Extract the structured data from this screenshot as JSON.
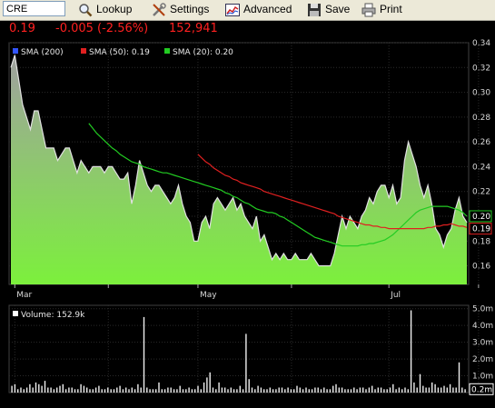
{
  "toolbar": {
    "ticker": "CRE",
    "lookup_label": "Lookup",
    "settings_label": "Settings",
    "advanced_label": "Advanced",
    "save_label": "Save",
    "print_label": "Print"
  },
  "quote": {
    "price": "0.19",
    "change": "-0.005 (-2.56%)",
    "volume": "152,941"
  },
  "colors": {
    "price_text": "#ff2020",
    "sma200": "#3355ff",
    "sma50": "#e02020",
    "sma20": "#22cc22",
    "area_top": "#a0a0a0",
    "area_bottom": "#7cf03c",
    "volume_bar": "#f0f0f0"
  },
  "chart_data": [
    {
      "type": "area",
      "legend": [
        {
          "name": "SMA (200)",
          "value": ""
        },
        {
          "name": "SMA (50)",
          "value": "0.19"
        },
        {
          "name": "SMA (20)",
          "value": "0.20"
        }
      ],
      "x_ticks": [
        "Mar",
        "May",
        "Jul"
      ],
      "y_ticks": [
        "0.34",
        "0.32",
        "0.30",
        "0.28",
        "0.26",
        "0.24",
        "0.22",
        "0.20",
        "0.18",
        "0.16"
      ],
      "ylim": [
        0.145,
        0.34
      ],
      "grid": true,
      "last_value_markers": [
        "0.20",
        "0.19"
      ],
      "series": [
        {
          "name": "Price",
          "values": [
            0.32,
            0.33,
            0.31,
            0.29,
            0.28,
            0.27,
            0.285,
            0.285,
            0.27,
            0.255,
            0.255,
            0.255,
            0.245,
            0.25,
            0.255,
            0.255,
            0.245,
            0.235,
            0.245,
            0.24,
            0.235,
            0.24,
            0.24,
            0.24,
            0.235,
            0.24,
            0.24,
            0.235,
            0.23,
            0.23,
            0.235,
            0.21,
            0.225,
            0.245,
            0.235,
            0.225,
            0.22,
            0.225,
            0.225,
            0.22,
            0.215,
            0.21,
            0.215,
            0.225,
            0.21,
            0.2,
            0.195,
            0.18,
            0.18,
            0.195,
            0.2,
            0.19,
            0.21,
            0.215,
            0.21,
            0.205,
            0.21,
            0.215,
            0.205,
            0.21,
            0.2,
            0.195,
            0.19,
            0.2,
            0.18,
            0.185,
            0.175,
            0.165,
            0.17,
            0.165,
            0.17,
            0.165,
            0.165,
            0.17,
            0.165,
            0.165,
            0.165,
            0.17,
            0.165,
            0.16,
            0.16,
            0.16,
            0.16,
            0.17,
            0.185,
            0.2,
            0.19,
            0.2,
            0.195,
            0.19,
            0.2,
            0.205,
            0.215,
            0.21,
            0.22,
            0.225,
            0.225,
            0.215,
            0.225,
            0.21,
            0.215,
            0.245,
            0.26,
            0.25,
            0.24,
            0.225,
            0.215,
            0.225,
            0.21,
            0.19,
            0.185,
            0.175,
            0.185,
            0.19,
            0.205,
            0.215,
            0.2,
            0.195
          ]
        },
        {
          "name": "SMA (20)",
          "values": [
            0.275,
            0.271,
            0.267,
            0.264,
            0.261,
            0.258,
            0.255,
            0.253,
            0.25,
            0.248,
            0.246,
            0.244,
            0.243,
            0.242,
            0.24,
            0.239,
            0.238,
            0.237,
            0.236,
            0.235,
            0.235,
            0.234,
            0.233,
            0.232,
            0.231,
            0.23,
            0.229,
            0.228,
            0.227,
            0.226,
            0.225,
            0.224,
            0.223,
            0.222,
            0.221,
            0.219,
            0.218,
            0.216,
            0.215,
            0.213,
            0.211,
            0.21,
            0.208,
            0.206,
            0.205,
            0.204,
            0.203,
            0.203,
            0.202,
            0.2,
            0.199,
            0.197,
            0.195,
            0.193,
            0.191,
            0.189,
            0.187,
            0.185,
            0.183,
            0.182,
            0.181,
            0.18,
            0.179,
            0.178,
            0.177,
            0.176,
            0.176,
            0.176,
            0.176,
            0.176,
            0.177,
            0.177,
            0.178,
            0.178,
            0.179,
            0.18,
            0.181,
            0.183,
            0.185,
            0.188,
            0.191,
            0.194,
            0.197,
            0.2,
            0.203,
            0.205,
            0.206,
            0.207,
            0.208,
            0.208,
            0.208,
            0.208,
            0.208,
            0.207,
            0.206,
            0.205,
            0.203,
            0.2
          ],
          "x_offset": 20
        },
        {
          "name": "SMA (50)",
          "values": [
            0.25,
            0.247,
            0.244,
            0.242,
            0.239,
            0.237,
            0.235,
            0.233,
            0.232,
            0.23,
            0.229,
            0.227,
            0.226,
            0.225,
            0.224,
            0.223,
            0.222,
            0.22,
            0.219,
            0.218,
            0.217,
            0.216,
            0.215,
            0.214,
            0.213,
            0.212,
            0.211,
            0.21,
            0.209,
            0.208,
            0.207,
            0.206,
            0.205,
            0.204,
            0.203,
            0.202,
            0.2,
            0.199,
            0.198,
            0.197,
            0.196,
            0.195,
            0.194,
            0.193,
            0.193,
            0.192,
            0.192,
            0.191,
            0.191,
            0.19,
            0.19,
            0.19,
            0.19,
            0.19,
            0.19,
            0.19,
            0.19,
            0.19,
            0.19,
            0.191,
            0.191,
            0.192,
            0.192,
            0.193,
            0.193,
            0.194,
            0.193,
            0.192,
            0.192,
            0.191
          ],
          "x_offset": 48
        }
      ]
    },
    {
      "type": "bar",
      "legend": [
        {
          "name": "Volume:",
          "value": "152.9k"
        }
      ],
      "y_ticks": [
        "5.0m",
        "4.0m",
        "3.0m",
        "2.0m",
        "1.0m"
      ],
      "last_value_marker": "0.2m",
      "ylim": [
        0,
        5.2
      ],
      "series": [
        {
          "name": "Volume",
          "values": [
            0.4,
            0.5,
            0.2,
            0.3,
            0.2,
            0.3,
            0.5,
            0.3,
            0.6,
            0.5,
            0.4,
            0.7,
            0.3,
            0.3,
            0.2,
            0.3,
            0.4,
            0.5,
            0.2,
            0.3,
            0.3,
            0.2,
            0.2,
            0.5,
            0.4,
            0.3,
            0.2,
            0.2,
            0.3,
            0.4,
            0.2,
            0.2,
            0.3,
            0.2,
            0.2,
            0.3,
            0.4,
            0.2,
            0.3,
            0.2,
            0.3,
            0.2,
            0.5,
            0.3,
            4.5,
            0.3,
            0.2,
            0.2,
            0.2,
            0.6,
            0.2,
            0.2,
            0.3,
            0.3,
            0.2,
            0.2,
            0.4,
            0.2,
            0.2,
            0.3,
            0.2,
            0.2,
            0.4,
            0.2,
            0.6,
            0.9,
            1.2,
            0.3,
            0.2,
            0.6,
            0.3,
            0.3,
            0.2,
            0.3,
            0.2,
            0.2,
            0.4,
            0.2,
            3.5,
            0.8,
            0.3,
            0.2,
            0.4,
            0.3,
            0.2,
            0.2,
            0.3,
            0.2,
            0.2,
            0.3,
            0.3,
            0.2,
            0.3,
            0.2,
            0.2,
            0.4,
            0.3,
            0.2,
            0.3,
            0.2,
            0.2,
            0.3,
            0.3,
            0.2,
            0.3,
            0.2,
            0.2,
            0.4,
            0.5,
            0.3,
            0.3,
            0.2,
            0.2,
            0.2,
            0.3,
            0.2,
            0.3,
            0.3,
            0.2,
            0.3,
            0.4,
            0.2,
            0.3,
            0.3,
            0.2,
            0.2,
            0.3,
            0.5,
            0.2,
            0.3,
            0.2,
            0.3,
            0.2,
            4.9,
            0.6,
            0.3,
            1.1,
            0.4,
            0.3,
            0.3,
            0.6,
            0.5,
            0.3,
            0.3,
            0.4,
            0.3,
            0.5,
            0.3,
            0.3,
            1.8,
            0.3,
            0.2
          ]
        }
      ]
    }
  ]
}
